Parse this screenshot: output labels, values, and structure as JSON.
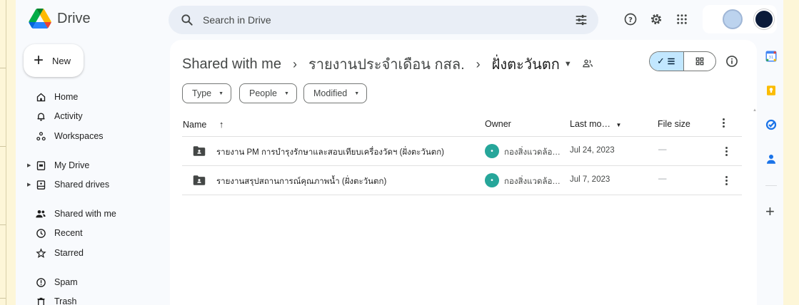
{
  "app": {
    "name": "Drive"
  },
  "search": {
    "placeholder": "Search in Drive"
  },
  "sidebar": {
    "new_label": "New",
    "items": [
      {
        "label": "Home"
      },
      {
        "label": "Activity"
      },
      {
        "label": "Workspaces"
      },
      {
        "label": "My Drive"
      },
      {
        "label": "Shared drives"
      },
      {
        "label": "Shared with me"
      },
      {
        "label": "Recent"
      },
      {
        "label": "Starred"
      },
      {
        "label": "Spam"
      },
      {
        "label": "Trash"
      }
    ]
  },
  "breadcrumb": {
    "root": "Shared with me",
    "parent": "รายงานประจำเดือน กสล.",
    "current": "ฝั่งตะวันตก"
  },
  "filters": {
    "type": "Type",
    "people": "People",
    "modified": "Modified"
  },
  "table": {
    "headers": {
      "name": "Name",
      "owner": "Owner",
      "last_modified": "Last mo…",
      "file_size": "File size"
    },
    "rows": [
      {
        "name": "รายงาน PM การบำรุงรักษาและสอบเทียบเครื่องวัดฯ (ฝั่งตะวันตก)",
        "owner": "กองสิ่งแวดล้อ…",
        "modified": "Jul 24, 2023",
        "size": "—"
      },
      {
        "name": "รายงานสรุปสถานการณ์คุณภาพน้ำ (ฝั่งตะวันตก)",
        "owner": "กองสิ่งแวดล้อ…",
        "modified": "Jul 7, 2023",
        "size": "—"
      }
    ]
  },
  "colors": {
    "accent": "#c2e7ff",
    "background": "#f8fafd",
    "owner_avatar": "#26a69a"
  }
}
